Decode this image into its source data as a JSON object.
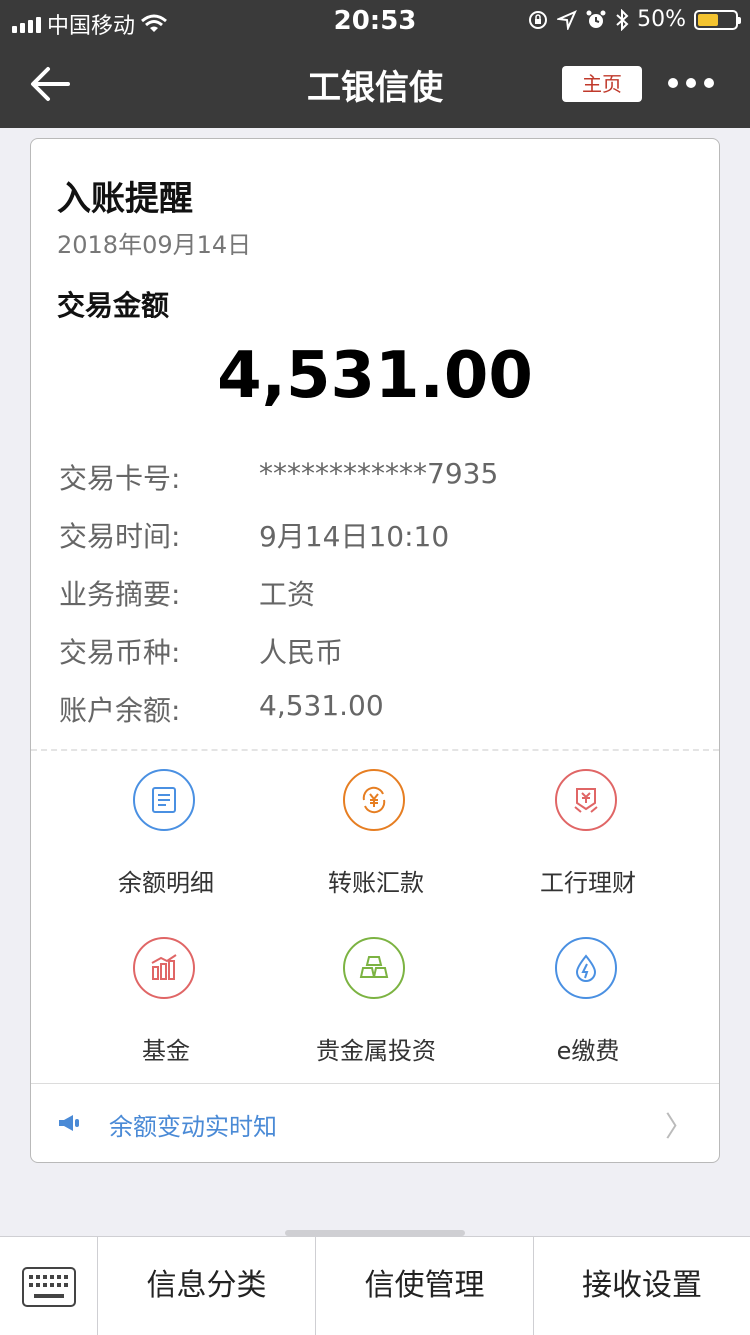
{
  "status_bar": {
    "carrier": "中国移动",
    "time": "20:53",
    "battery_percent": "50%",
    "battery_level": 0.5
  },
  "nav": {
    "title": "工银信使",
    "home_label": "主页"
  },
  "card": {
    "title": "入账提醒",
    "date": "2018年09月14日",
    "amount_label": "交易金额",
    "amount": "4,531.00",
    "rows": [
      {
        "key": "交易卡号:",
        "value": "************7935"
      },
      {
        "key": "交易时间:",
        "value": "9月14日10:10"
      },
      {
        "key": "业务摘要:",
        "value": "工资"
      },
      {
        "key": "交易币种:",
        "value": "人民币"
      },
      {
        "key": "账户余额:",
        "value": "4,531.00"
      }
    ],
    "shortcuts": [
      {
        "label": "余额明细",
        "icon": "document-icon",
        "color": "#4a90e2"
      },
      {
        "label": "转账汇款",
        "icon": "yuan-exchange-icon",
        "color": "#e67e22"
      },
      {
        "label": "工行理财",
        "icon": "wealth-icon",
        "color": "#e06666"
      },
      {
        "label": "基金",
        "icon": "bar-chart-icon",
        "color": "#e06666"
      },
      {
        "label": "贵金属投资",
        "icon": "gold-bars-icon",
        "color": "#7cb342"
      },
      {
        "label": "e缴费",
        "icon": "water-drop-icon",
        "color": "#4a90e2"
      }
    ],
    "notice": "余额变动实时知"
  },
  "bottom_bar": {
    "tabs": [
      "信息分类",
      "信使管理",
      "接收设置"
    ]
  }
}
